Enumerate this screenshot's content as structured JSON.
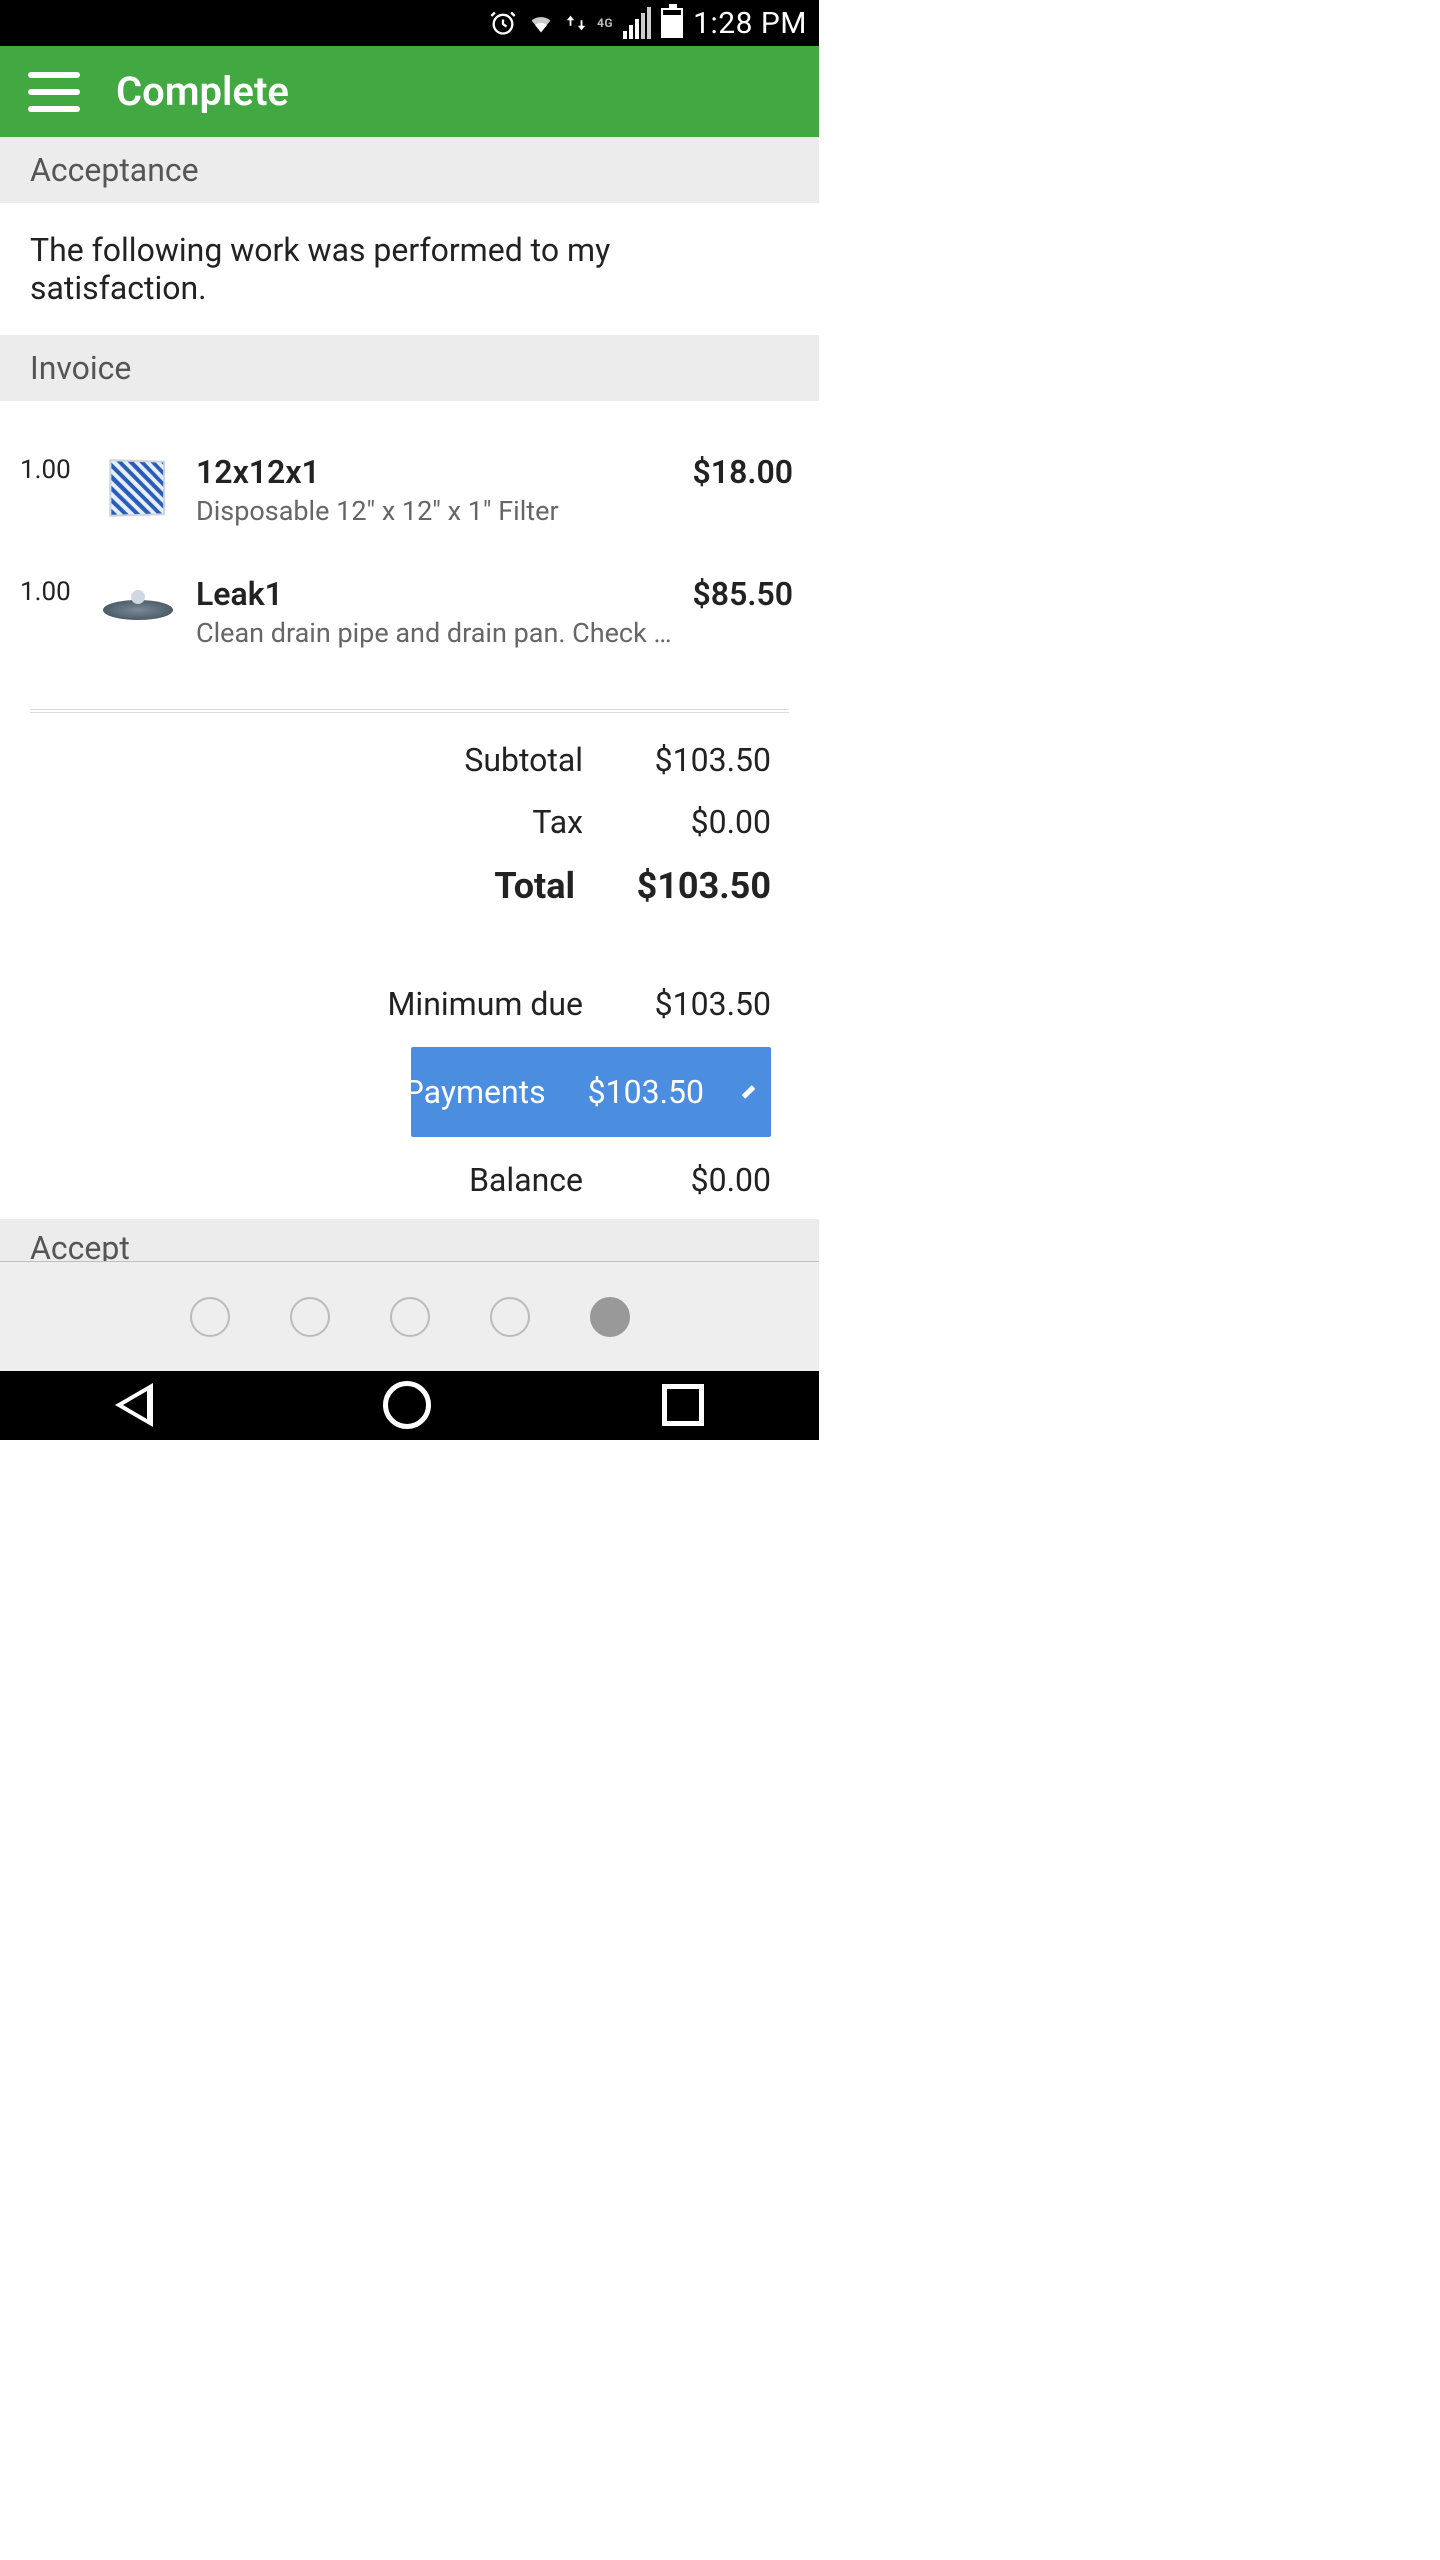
{
  "status_bar": {
    "network_tech": "4G",
    "time": "1:28 PM"
  },
  "header": {
    "title": "Complete"
  },
  "sections": {
    "acceptance_label": "Acceptance",
    "acceptance_text": "The following work was performed to my satisfaction.",
    "invoice_label": "Invoice",
    "accept_label": "Accept"
  },
  "invoice": {
    "items": [
      {
        "qty": "1.00",
        "title": "12x12x1",
        "desc": "Disposable 12\" x 12\" x 1\" Filter",
        "price": "$18.00",
        "icon": "filter"
      },
      {
        "qty": "1.00",
        "title": "Leak1",
        "desc": "Clean drain pipe and drain pan. Check to ensure dr…",
        "price": "$85.50",
        "icon": "pan"
      }
    ],
    "subtotal_label": "Subtotal",
    "subtotal_value": "$103.50",
    "tax_label": "Tax",
    "tax_value": "$0.00",
    "total_label": "Total",
    "total_value": "$103.50",
    "min_due_label": "Minimum due",
    "min_due_value": "$103.50",
    "payments_label": "Payments",
    "payments_value": "$103.50",
    "balance_label": "Balance",
    "balance_value": "$0.00"
  },
  "pager": {
    "count": 5,
    "active_index": 4
  }
}
